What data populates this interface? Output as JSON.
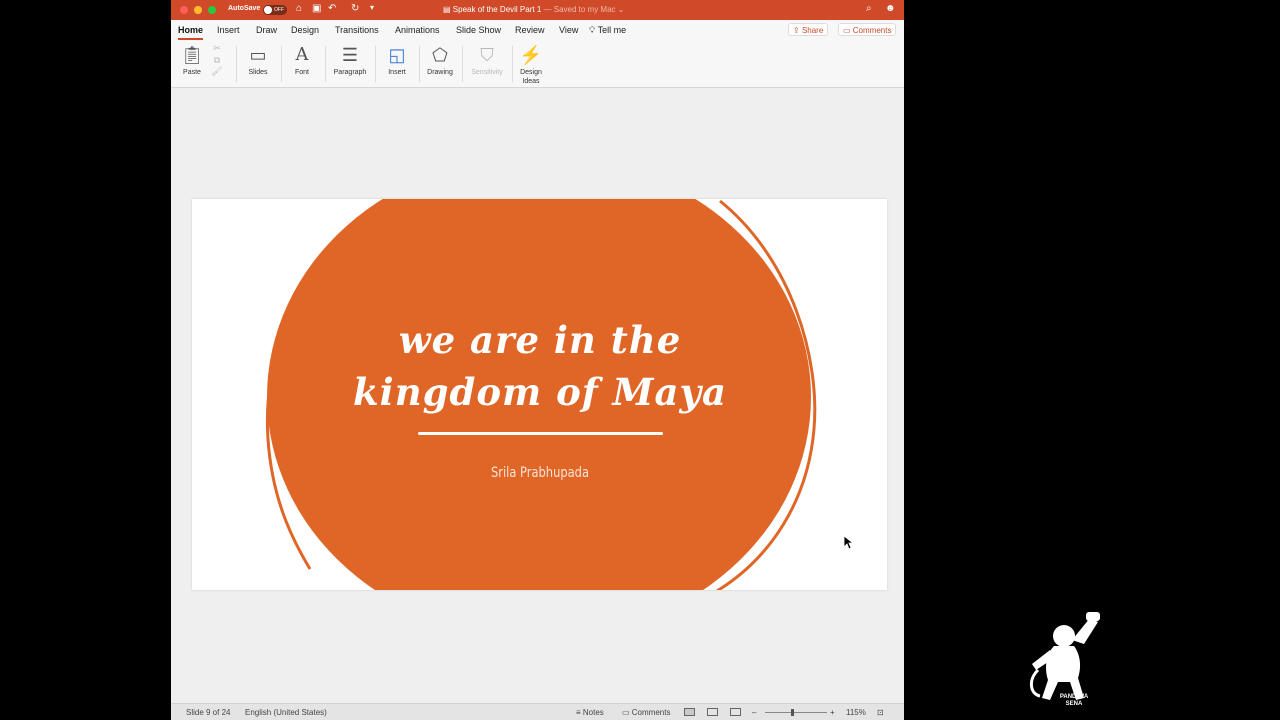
{
  "titlebar": {
    "autosave_label": "AutoSave",
    "autosave_state": "OFF",
    "doc_name": "Speak of the Devil Part 1",
    "saved_status": " — Saved to my Mac ⌄"
  },
  "tabs": [
    {
      "label": "Home",
      "active": true
    },
    {
      "label": "Insert"
    },
    {
      "label": "Draw"
    },
    {
      "label": "Design"
    },
    {
      "label": "Transitions"
    },
    {
      "label": "Animations"
    },
    {
      "label": "Slide Show"
    },
    {
      "label": "Review"
    },
    {
      "label": "View"
    }
  ],
  "tell_me": "Tell me",
  "share_label": "Share",
  "comments_label": "Comments",
  "ribbon": {
    "paste": "Paste",
    "slides": "Slides",
    "font": "Font",
    "paragraph": "Paragraph",
    "insert": "Insert",
    "drawing": "Drawing",
    "sensitivity": "Sensitivity",
    "design_ideas_1": "Design",
    "design_ideas_2": "Ideas"
  },
  "slide": {
    "title_line1": "we are in the",
    "title_line2": "kingdom of Maya",
    "subtitle": "Srila Prabhupada",
    "circle_color": "#e06627"
  },
  "statusbar": {
    "slide_info": "Slide 9 of 24",
    "language": "English (United States)",
    "notes": "Notes",
    "comments": "Comments",
    "zoom": "115%",
    "zoom_minus": "–",
    "zoom_plus": "+"
  },
  "logo": {
    "line1": "PANDAVA",
    "line2": "SENA"
  }
}
